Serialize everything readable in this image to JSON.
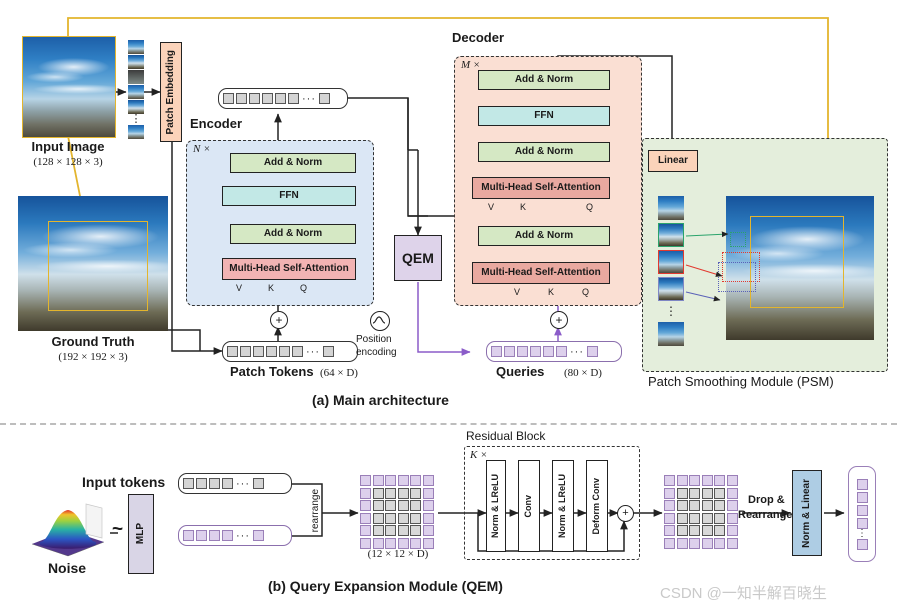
{
  "figure": {
    "caption_a": "(a) Main architecture",
    "caption_b": "(b) Query  Expansion Module (QEM)",
    "watermark": "CSDN @一知半解百晓生"
  },
  "main": {
    "input_image": {
      "label": "Input Image",
      "dims": "(128 × 128 × 3)"
    },
    "ground_truth": {
      "label": "Ground Truth",
      "dims": "(192 × 192 × 3)"
    },
    "patch_embedding": {
      "label": "Patch Embedding"
    },
    "encoder": {
      "title": "Encoder",
      "repeat": "N ×",
      "blocks": [
        "Add & Norm",
        "FFN",
        "Add & Norm",
        "Multi-Head Self-Attention"
      ],
      "qkv": [
        "V",
        "K",
        "Q"
      ]
    },
    "decoder": {
      "title": "Decoder",
      "repeat": "M ×",
      "blocks": [
        "Add & Norm",
        "FFN",
        "Add & Norm",
        "Multi-Head Self-Attention",
        "Add & Norm",
        "Multi-Head Self-Attention"
      ],
      "qkv": [
        "V",
        "K",
        "Q"
      ]
    },
    "qem_block": {
      "label": "QEM"
    },
    "position_encoding": {
      "line1": "Position",
      "line2": "encoding"
    },
    "patch_tokens": {
      "label": "Patch Tokens",
      "dims": "(64 × D)"
    },
    "queries": {
      "label": "Queries",
      "dims": "(80 × D)"
    },
    "psm": {
      "title": "Patch Smoothing Module (PSM)",
      "linear": "Linear"
    }
  },
  "qem": {
    "input_tokens": {
      "label": "Input tokens"
    },
    "noise": {
      "label": "Noise"
    },
    "tilde": "~",
    "mlp": {
      "label": "MLP"
    },
    "rearrange": {
      "label": "rearrange"
    },
    "grid_dims": "(12 × 12 × D)",
    "residual_block": {
      "title": "Residual Block",
      "repeat": "K ×",
      "blocks": [
        "Norm & LReLU",
        "Conv",
        "Norm & LReLU",
        "Deform Conv"
      ]
    },
    "drop_rearrange": {
      "line1": "Drop &",
      "line2": "Rearrange"
    },
    "norm_linear": {
      "label": "Norm & Linear"
    }
  },
  "colors": {
    "add_norm": "#d5e8c4",
    "ffn": "#c2e8e6",
    "mhsa_encoder": "#f2b3b3",
    "mhsa_decoder": "#e9a9a0",
    "qem": "#ded3ea",
    "linear": "#fbd3ba",
    "encoder_panel": "#dbe7f5",
    "decoder_panel": "#fadfd3",
    "psm_panel": "#e4eedc",
    "norm_linear": "#aecde4",
    "mlp": "#d9d5e6",
    "query_purple": "#9a7fb8",
    "highlight_yellow": "#e3b52d"
  }
}
